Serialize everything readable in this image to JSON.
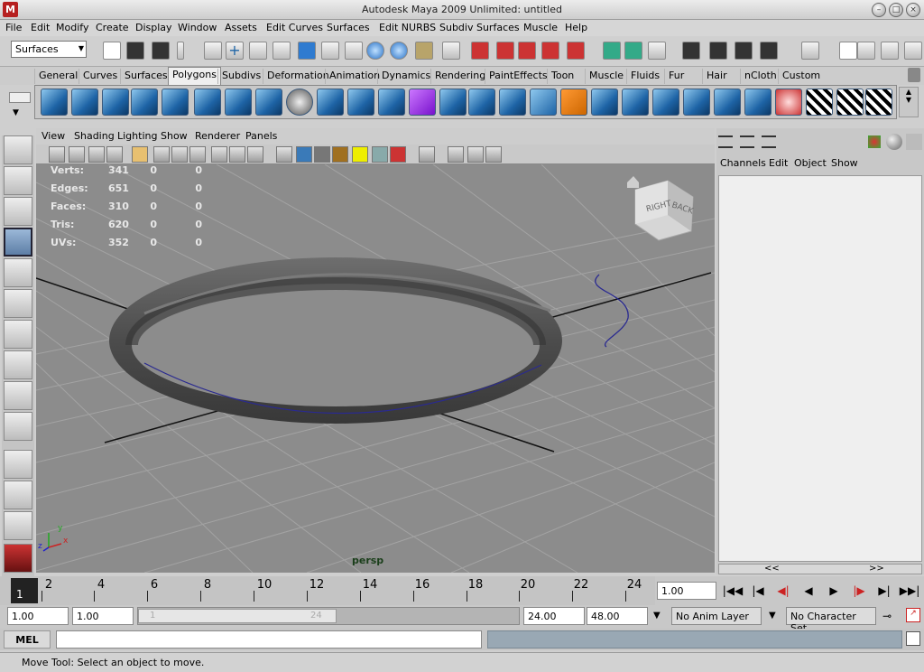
{
  "window": {
    "title": "Autodesk Maya 2009 Unlimited: untitled",
    "app_icon": "maya-icon"
  },
  "menubar": [
    "File",
    "Edit",
    "Modify",
    "Create",
    "Display",
    "Window",
    "Assets",
    "Edit Curves",
    "Surfaces",
    "Edit NURBS",
    "Subdiv Surfaces",
    "Muscle",
    "Help"
  ],
  "status_line": {
    "menu_set": "Surfaces"
  },
  "shelf_tabs": [
    "General",
    "Curves",
    "Surfaces",
    "Polygons",
    "Subdivs",
    "Deformation",
    "Animation",
    "Dynamics",
    "Rendering",
    "PaintEffects",
    "Toon",
    "Muscle",
    "Fluids",
    "Fur",
    "Hair",
    "nCloth",
    "Custom"
  ],
  "active_shelf_tab": "Polygons",
  "panel_menu": [
    "View",
    "Shading",
    "Lighting",
    "Show",
    "Renderer",
    "Panels"
  ],
  "hud": {
    "rows": [
      {
        "label": "Verts:",
        "v1": "341",
        "v2": "0",
        "v3": "0"
      },
      {
        "label": "Edges:",
        "v1": "651",
        "v2": "0",
        "v3": "0"
      },
      {
        "label": "Faces:",
        "v1": "310",
        "v2": "0",
        "v3": "0"
      },
      {
        "label": "Tris:",
        "v1": "620",
        "v2": "0",
        "v3": "0"
      },
      {
        "label": "UVs:",
        "v1": "352",
        "v2": "0",
        "v3": "0"
      }
    ],
    "camera": "persp",
    "viewcube": {
      "right": "RIGHT",
      "back": "BACK"
    },
    "axis_x": "x",
    "axis_y": "y",
    "axis_z": "z"
  },
  "channel_box": {
    "menu": [
      "Channels",
      "Edit",
      "Object",
      "Show"
    ],
    "scroll_left": "<<",
    "scroll_right": ">>"
  },
  "timeline": {
    "current_frame": "1",
    "labels": [
      "2",
      "4",
      "6",
      "8",
      "10",
      "12",
      "14",
      "16",
      "18",
      "20",
      "22",
      "24"
    ]
  },
  "transport": {
    "current_time": "1.00"
  },
  "range": {
    "start_time": "1.00",
    "playback_start": "1.00",
    "slider_start": "1",
    "slider_end": "24",
    "playback_end": "24.00",
    "end_time": "48.00",
    "anim_layer": "No Anim Layer",
    "character_set": "No Character Set"
  },
  "command_line": {
    "label": "MEL",
    "value": ""
  },
  "help_line": "Move Tool: Select an object to move.",
  "colors": {
    "viewport_bg": "#8c8c8c",
    "torus": "#5a5a5a",
    "grid": "#a2a2a2",
    "timeline_current": "#222222",
    "maya_red": "#b62020"
  }
}
